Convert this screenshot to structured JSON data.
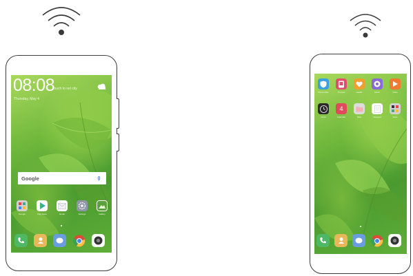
{
  "colors": {
    "phone_outline": "#3a3a3a",
    "wallpaper_light": "#a9d85c",
    "wallpaper_dark": "#4a9a30",
    "wifi": "#3a3a3a"
  },
  "left_phone": {
    "lock_clock": "08:08",
    "weather_text": "Touch to set city",
    "date_text": "Thursday, May 4",
    "search": {
      "brand": "Google"
    },
    "apps": [
      {
        "label": "Google",
        "icon": "google-folder-icon",
        "color": "#c9c9c9"
      },
      {
        "label": "Play Store",
        "icon": "play-store-icon",
        "color": "#ffffff"
      },
      {
        "label": "Email",
        "icon": "email-icon",
        "color": "#ffffff"
      },
      {
        "label": "Settings",
        "icon": "settings-icon",
        "color": "#8a8fa0"
      },
      {
        "label": "Gallery",
        "icon": "gallery-icon",
        "color": "#5aa13d"
      }
    ],
    "dock": [
      {
        "icon": "phone-icon",
        "color": "#46b060"
      },
      {
        "icon": "contacts-icon",
        "color": "#e5b050"
      },
      {
        "icon": "messaging-icon",
        "color": "#5a8fd8"
      },
      {
        "icon": "chrome-icon",
        "color": "#ffffff"
      },
      {
        "icon": "camera-icon",
        "color": "#3a3a3a"
      }
    ]
  },
  "right_phone": {
    "row1": [
      {
        "label": "Phone Man.",
        "icon": "phone-manager-icon",
        "color": "#3aa0e0"
      },
      {
        "label": "Themes",
        "icon": "themes-icon",
        "color": "#e04e6c"
      },
      {
        "label": "Health",
        "icon": "health-icon",
        "color": "#f0a030"
      },
      {
        "label": "Music",
        "icon": "music-icon",
        "color": "#8a6ad8"
      },
      {
        "label": "Video",
        "icon": "video-icon",
        "color": "#f07a30"
      }
    ],
    "row2": [
      {
        "label": "Clock",
        "icon": "clock-icon",
        "color": "#2a2a2a"
      },
      {
        "label": "Calendar",
        "icon": "calendar-icon",
        "color": "#e04a5a",
        "value": "4"
      },
      {
        "label": "Files",
        "icon": "files-icon",
        "color": "#d9d9d9"
      },
      {
        "label": "Notepad",
        "icon": "notepad-icon",
        "color": "#ffffff"
      },
      {
        "label": "Tools",
        "icon": "tools-folder-icon",
        "color": "#c9c9c9"
      }
    ],
    "dock": [
      {
        "icon": "phone-icon",
        "color": "#46b060"
      },
      {
        "icon": "contacts-icon",
        "color": "#e5b050"
      },
      {
        "icon": "messaging-icon",
        "color": "#5a8fd8"
      },
      {
        "icon": "chrome-icon",
        "color": "#ffffff"
      },
      {
        "icon": "camera-icon",
        "color": "#3a3a3a"
      }
    ]
  }
}
